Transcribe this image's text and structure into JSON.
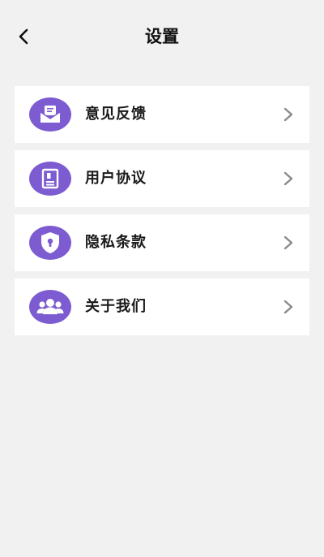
{
  "header": {
    "title": "设置",
    "back_icon": "chevron-left-icon"
  },
  "menu": {
    "items": [
      {
        "label": "意见反馈",
        "icon": "feedback-envelope-icon"
      },
      {
        "label": "用户协议",
        "icon": "user-agreement-document-icon"
      },
      {
        "label": "隐私条款",
        "icon": "privacy-shield-icon"
      },
      {
        "label": "关于我们",
        "icon": "about-us-group-icon"
      }
    ]
  },
  "colors": {
    "background": "#f1f1f1",
    "card": "#ffffff",
    "accent": "#7d5bd0",
    "text": "#1a1a1a",
    "chevron": "#8a8a8a"
  }
}
